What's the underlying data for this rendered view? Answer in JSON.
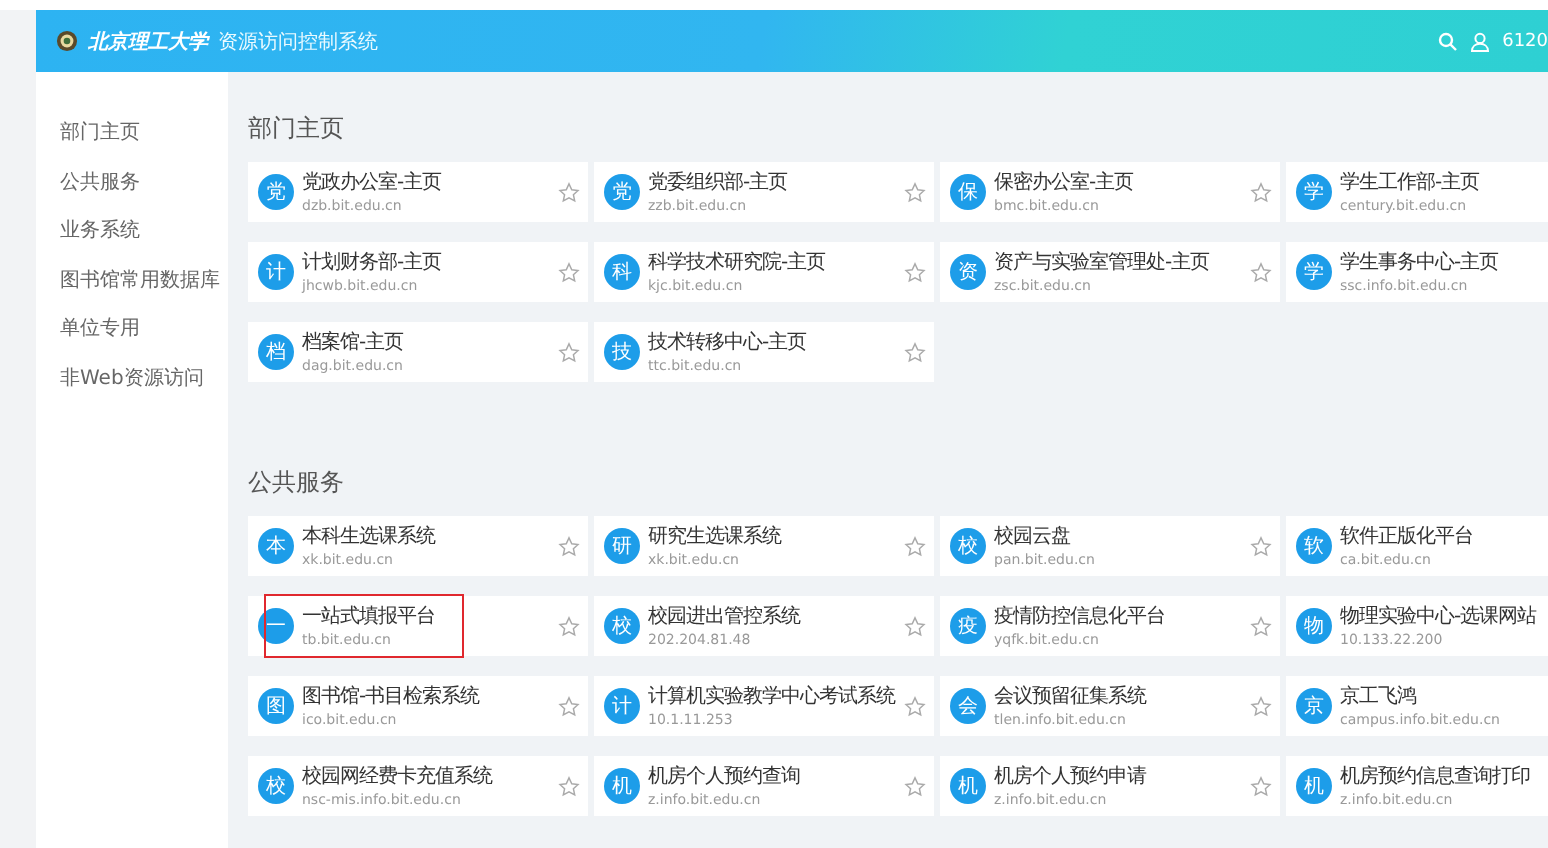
{
  "header": {
    "logo_text": "北京理工大学",
    "title": "资源访问控制系统",
    "user": "6120"
  },
  "sidebar": {
    "items": [
      {
        "label": "部门主页"
      },
      {
        "label": "公共服务"
      },
      {
        "label": "业务系统"
      },
      {
        "label": "图书馆常用数据库"
      },
      {
        "label": "单位专用"
      },
      {
        "label": "非Web资源访问"
      }
    ]
  },
  "sections": [
    {
      "title": "部门主页",
      "cards": [
        {
          "badge": "党",
          "title": "党政办公室-主页",
          "url": "dzb.bit.edu.cn",
          "highlighted": false
        },
        {
          "badge": "党",
          "title": "党委组织部-主页",
          "url": "zzb.bit.edu.cn",
          "highlighted": false
        },
        {
          "badge": "保",
          "title": "保密办公室-主页",
          "url": "bmc.bit.edu.cn",
          "highlighted": false
        },
        {
          "badge": "学",
          "title": "学生工作部-主页",
          "url": "century.bit.edu.cn",
          "highlighted": false
        },
        {
          "badge": "计",
          "title": "计划财务部-主页",
          "url": "jhcwb.bit.edu.cn",
          "highlighted": false
        },
        {
          "badge": "科",
          "title": "科学技术研究院-主页",
          "url": "kjc.bit.edu.cn",
          "highlighted": false
        },
        {
          "badge": "资",
          "title": "资产与实验室管理处-主页",
          "url": "zsc.bit.edu.cn",
          "highlighted": false
        },
        {
          "badge": "学",
          "title": "学生事务中心-主页",
          "url": "ssc.info.bit.edu.cn",
          "highlighted": false
        },
        {
          "badge": "档",
          "title": "档案馆-主页",
          "url": "dag.bit.edu.cn",
          "highlighted": false
        },
        {
          "badge": "技",
          "title": "技术转移中心-主页",
          "url": "ttc.bit.edu.cn",
          "highlighted": false
        }
      ]
    },
    {
      "title": "公共服务",
      "cards": [
        {
          "badge": "本",
          "title": "本科生选课系统",
          "url": "xk.bit.edu.cn",
          "highlighted": false
        },
        {
          "badge": "研",
          "title": "研究生选课系统",
          "url": "xk.bit.edu.cn",
          "highlighted": false
        },
        {
          "badge": "校",
          "title": "校园云盘",
          "url": "pan.bit.edu.cn",
          "highlighted": false
        },
        {
          "badge": "软",
          "title": "软件正版化平台",
          "url": "ca.bit.edu.cn",
          "highlighted": false
        },
        {
          "badge": "一",
          "title": "一站式填报平台",
          "url": "tb.bit.edu.cn",
          "highlighted": true
        },
        {
          "badge": "校",
          "title": "校园进出管控系统",
          "url": "202.204.81.48",
          "highlighted": false
        },
        {
          "badge": "疫",
          "title": "疫情防控信息化平台",
          "url": "yqfk.bit.edu.cn",
          "highlighted": false
        },
        {
          "badge": "物",
          "title": "物理实验中心-选课网站",
          "url": "10.133.22.200",
          "highlighted": false
        },
        {
          "badge": "图",
          "title": "图书馆-书目检索系统",
          "url": "ico.bit.edu.cn",
          "highlighted": false
        },
        {
          "badge": "计",
          "title": "计算机实验教学中心考试系统",
          "url": "10.1.11.253",
          "highlighted": false
        },
        {
          "badge": "会",
          "title": "会议预留征集系统",
          "url": "tlen.info.bit.edu.cn",
          "highlighted": false
        },
        {
          "badge": "京",
          "title": "京工飞鸿",
          "url": "campus.info.bit.edu.cn",
          "highlighted": false
        },
        {
          "badge": "校",
          "title": "校园网经费卡充值系统",
          "url": "nsc-mis.info.bit.edu.cn",
          "highlighted": false
        },
        {
          "badge": "机",
          "title": "机房个人预约查询",
          "url": "z.info.bit.edu.cn",
          "highlighted": false
        },
        {
          "badge": "机",
          "title": "机房个人预约申请",
          "url": "z.info.bit.edu.cn",
          "highlighted": false
        },
        {
          "badge": "机",
          "title": "机房预约信息查询打印",
          "url": "z.info.bit.edu.cn",
          "highlighted": false
        }
      ]
    }
  ]
}
